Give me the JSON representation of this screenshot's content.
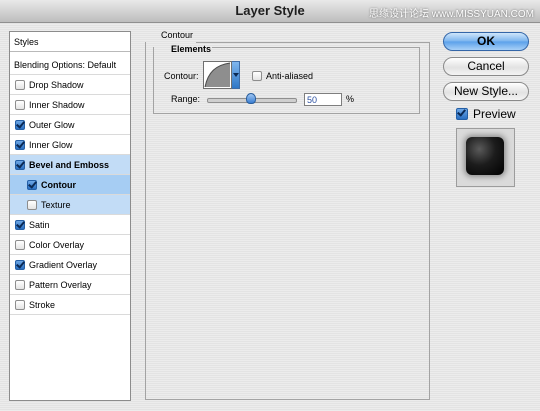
{
  "window": {
    "title": "Layer Style",
    "watermark": "思缘设计论坛 www.MISSYUAN.COM"
  },
  "sidebar": {
    "items": [
      {
        "label": "Styles",
        "checked": null,
        "bold": false
      },
      {
        "label": "Blending Options: Default",
        "checked": null,
        "bold": false
      },
      {
        "label": "Drop Shadow",
        "checked": false,
        "bold": false
      },
      {
        "label": "Inner Shadow",
        "checked": false,
        "bold": false
      },
      {
        "label": "Outer Glow",
        "checked": true,
        "bold": false
      },
      {
        "label": "Inner Glow",
        "checked": true,
        "bold": false
      },
      {
        "label": "Bevel and Emboss",
        "checked": true,
        "bold": true
      },
      {
        "label": "Contour",
        "checked": true,
        "bold": true
      },
      {
        "label": "Texture",
        "checked": false,
        "bold": false
      },
      {
        "label": "Satin",
        "checked": true,
        "bold": false
      },
      {
        "label": "Color Overlay",
        "checked": false,
        "bold": false
      },
      {
        "label": "Gradient Overlay",
        "checked": true,
        "bold": false
      },
      {
        "label": "Pattern Overlay",
        "checked": false,
        "bold": false
      },
      {
        "label": "Stroke",
        "checked": false,
        "bold": false
      }
    ]
  },
  "panel": {
    "title": "Contour",
    "elements_title": "Elements",
    "contour_label": "Contour:",
    "anti_aliased_label": "Anti-aliased",
    "anti_aliased_checked": false,
    "range_label": "Range:",
    "range_value": "50",
    "range_unit": "%"
  },
  "buttons": {
    "ok": "OK",
    "cancel": "Cancel",
    "new_style": "New Style..."
  },
  "preview": {
    "label": "Preview",
    "checked": true
  },
  "colors": {
    "selection": "#c2dcf6",
    "accent": "#5aa0ea"
  }
}
